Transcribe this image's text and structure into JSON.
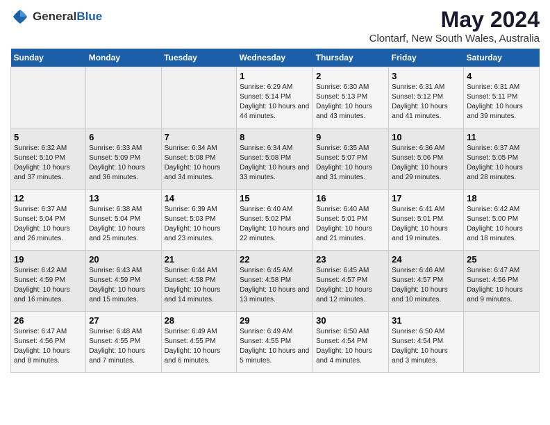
{
  "logo": {
    "text_general": "General",
    "text_blue": "Blue"
  },
  "header": {
    "title": "May 2024",
    "subtitle": "Clontarf, New South Wales, Australia"
  },
  "days_of_week": [
    "Sunday",
    "Monday",
    "Tuesday",
    "Wednesday",
    "Thursday",
    "Friday",
    "Saturday"
  ],
  "weeks": [
    {
      "days": [
        {
          "num": "",
          "sunrise": "",
          "sunset": "",
          "daylight": ""
        },
        {
          "num": "",
          "sunrise": "",
          "sunset": "",
          "daylight": ""
        },
        {
          "num": "",
          "sunrise": "",
          "sunset": "",
          "daylight": ""
        },
        {
          "num": "1",
          "sunrise": "Sunrise: 6:29 AM",
          "sunset": "Sunset: 5:14 PM",
          "daylight": "Daylight: 10 hours and 44 minutes."
        },
        {
          "num": "2",
          "sunrise": "Sunrise: 6:30 AM",
          "sunset": "Sunset: 5:13 PM",
          "daylight": "Daylight: 10 hours and 43 minutes."
        },
        {
          "num": "3",
          "sunrise": "Sunrise: 6:31 AM",
          "sunset": "Sunset: 5:12 PM",
          "daylight": "Daylight: 10 hours and 41 minutes."
        },
        {
          "num": "4",
          "sunrise": "Sunrise: 6:31 AM",
          "sunset": "Sunset: 5:11 PM",
          "daylight": "Daylight: 10 hours and 39 minutes."
        }
      ]
    },
    {
      "days": [
        {
          "num": "5",
          "sunrise": "Sunrise: 6:32 AM",
          "sunset": "Sunset: 5:10 PM",
          "daylight": "Daylight: 10 hours and 37 minutes."
        },
        {
          "num": "6",
          "sunrise": "Sunrise: 6:33 AM",
          "sunset": "Sunset: 5:09 PM",
          "daylight": "Daylight: 10 hours and 36 minutes."
        },
        {
          "num": "7",
          "sunrise": "Sunrise: 6:34 AM",
          "sunset": "Sunset: 5:08 PM",
          "daylight": "Daylight: 10 hours and 34 minutes."
        },
        {
          "num": "8",
          "sunrise": "Sunrise: 6:34 AM",
          "sunset": "Sunset: 5:08 PM",
          "daylight": "Daylight: 10 hours and 33 minutes."
        },
        {
          "num": "9",
          "sunrise": "Sunrise: 6:35 AM",
          "sunset": "Sunset: 5:07 PM",
          "daylight": "Daylight: 10 hours and 31 minutes."
        },
        {
          "num": "10",
          "sunrise": "Sunrise: 6:36 AM",
          "sunset": "Sunset: 5:06 PM",
          "daylight": "Daylight: 10 hours and 29 minutes."
        },
        {
          "num": "11",
          "sunrise": "Sunrise: 6:37 AM",
          "sunset": "Sunset: 5:05 PM",
          "daylight": "Daylight: 10 hours and 28 minutes."
        }
      ]
    },
    {
      "days": [
        {
          "num": "12",
          "sunrise": "Sunrise: 6:37 AM",
          "sunset": "Sunset: 5:04 PM",
          "daylight": "Daylight: 10 hours and 26 minutes."
        },
        {
          "num": "13",
          "sunrise": "Sunrise: 6:38 AM",
          "sunset": "Sunset: 5:04 PM",
          "daylight": "Daylight: 10 hours and 25 minutes."
        },
        {
          "num": "14",
          "sunrise": "Sunrise: 6:39 AM",
          "sunset": "Sunset: 5:03 PM",
          "daylight": "Daylight: 10 hours and 23 minutes."
        },
        {
          "num": "15",
          "sunrise": "Sunrise: 6:40 AM",
          "sunset": "Sunset: 5:02 PM",
          "daylight": "Daylight: 10 hours and 22 minutes."
        },
        {
          "num": "16",
          "sunrise": "Sunrise: 6:40 AM",
          "sunset": "Sunset: 5:01 PM",
          "daylight": "Daylight: 10 hours and 21 minutes."
        },
        {
          "num": "17",
          "sunrise": "Sunrise: 6:41 AM",
          "sunset": "Sunset: 5:01 PM",
          "daylight": "Daylight: 10 hours and 19 minutes."
        },
        {
          "num": "18",
          "sunrise": "Sunrise: 6:42 AM",
          "sunset": "Sunset: 5:00 PM",
          "daylight": "Daylight: 10 hours and 18 minutes."
        }
      ]
    },
    {
      "days": [
        {
          "num": "19",
          "sunrise": "Sunrise: 6:42 AM",
          "sunset": "Sunset: 4:59 PM",
          "daylight": "Daylight: 10 hours and 16 minutes."
        },
        {
          "num": "20",
          "sunrise": "Sunrise: 6:43 AM",
          "sunset": "Sunset: 4:59 PM",
          "daylight": "Daylight: 10 hours and 15 minutes."
        },
        {
          "num": "21",
          "sunrise": "Sunrise: 6:44 AM",
          "sunset": "Sunset: 4:58 PM",
          "daylight": "Daylight: 10 hours and 14 minutes."
        },
        {
          "num": "22",
          "sunrise": "Sunrise: 6:45 AM",
          "sunset": "Sunset: 4:58 PM",
          "daylight": "Daylight: 10 hours and 13 minutes."
        },
        {
          "num": "23",
          "sunrise": "Sunrise: 6:45 AM",
          "sunset": "Sunset: 4:57 PM",
          "daylight": "Daylight: 10 hours and 12 minutes."
        },
        {
          "num": "24",
          "sunrise": "Sunrise: 6:46 AM",
          "sunset": "Sunset: 4:57 PM",
          "daylight": "Daylight: 10 hours and 10 minutes."
        },
        {
          "num": "25",
          "sunrise": "Sunrise: 6:47 AM",
          "sunset": "Sunset: 4:56 PM",
          "daylight": "Daylight: 10 hours and 9 minutes."
        }
      ]
    },
    {
      "days": [
        {
          "num": "26",
          "sunrise": "Sunrise: 6:47 AM",
          "sunset": "Sunset: 4:56 PM",
          "daylight": "Daylight: 10 hours and 8 minutes."
        },
        {
          "num": "27",
          "sunrise": "Sunrise: 6:48 AM",
          "sunset": "Sunset: 4:55 PM",
          "daylight": "Daylight: 10 hours and 7 minutes."
        },
        {
          "num": "28",
          "sunrise": "Sunrise: 6:49 AM",
          "sunset": "Sunset: 4:55 PM",
          "daylight": "Daylight: 10 hours and 6 minutes."
        },
        {
          "num": "29",
          "sunrise": "Sunrise: 6:49 AM",
          "sunset": "Sunset: 4:55 PM",
          "daylight": "Daylight: 10 hours and 5 minutes."
        },
        {
          "num": "30",
          "sunrise": "Sunrise: 6:50 AM",
          "sunset": "Sunset: 4:54 PM",
          "daylight": "Daylight: 10 hours and 4 minutes."
        },
        {
          "num": "31",
          "sunrise": "Sunrise: 6:50 AM",
          "sunset": "Sunset: 4:54 PM",
          "daylight": "Daylight: 10 hours and 3 minutes."
        },
        {
          "num": "",
          "sunrise": "",
          "sunset": "",
          "daylight": ""
        }
      ]
    }
  ]
}
